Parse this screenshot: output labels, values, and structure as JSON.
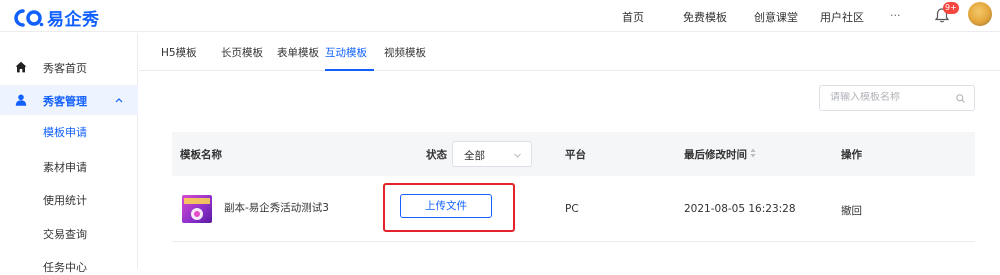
{
  "brand": {
    "name": "易企秀"
  },
  "topnav": {
    "items": [
      "首页",
      "免费模板",
      "创意课堂",
      "用户社区",
      "···"
    ],
    "badge": "9+"
  },
  "sidebar": {
    "home": "秀客首页",
    "manage": "秀客管理",
    "sub_items": [
      "模板申请",
      "素材申请",
      "使用统计",
      "交易查询",
      "任务中心"
    ],
    "active_sub": "模板申请"
  },
  "tabs": [
    "H5模板",
    "长页模板",
    "表单模板",
    "互动模板",
    "视频模板"
  ],
  "active_tab": "互动模板",
  "search": {
    "placeholder": "请输入模板名称"
  },
  "table": {
    "headers": {
      "name": "模板名称",
      "status": "状态",
      "status_value": "全部",
      "platform": "平台",
      "modified": "最后修改时间",
      "actions": "操作"
    },
    "rows": [
      {
        "name": "副本-易企秀活动测试3",
        "action_button": "上传文件",
        "platform": "PC",
        "modified": "2021-08-05 16:23:28",
        "op": "撤回"
      }
    ]
  },
  "colors": {
    "accent": "#1261ff",
    "highlight": "#e5232a",
    "badge": "#f5473e"
  }
}
